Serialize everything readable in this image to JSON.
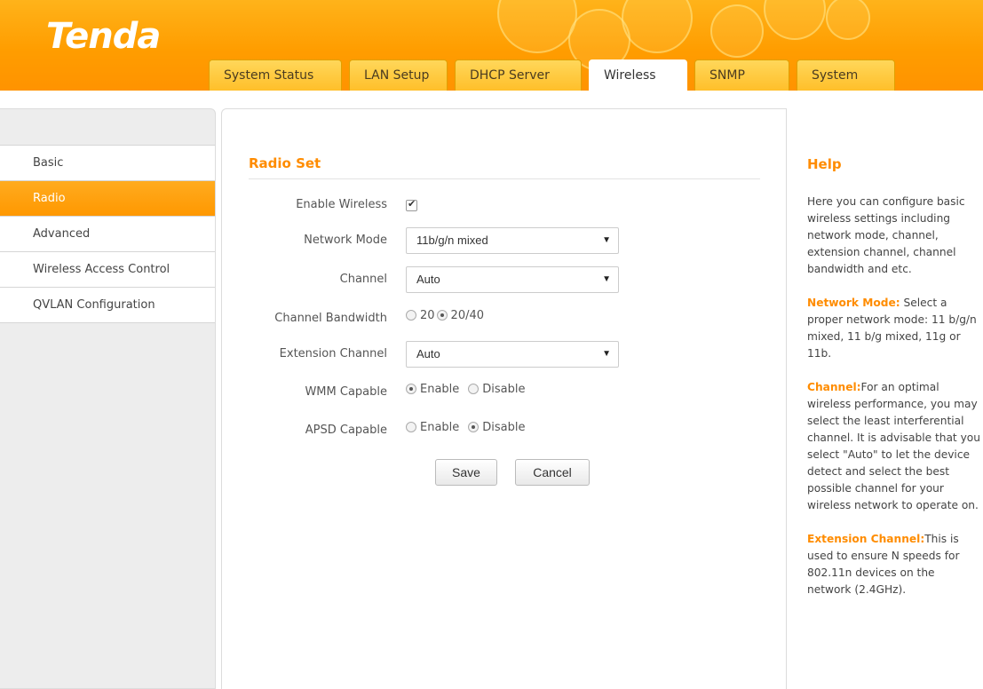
{
  "brand": {
    "logo_text": "Tenda"
  },
  "tabs": [
    {
      "label": "System Status"
    },
    {
      "label": "LAN Setup"
    },
    {
      "label": "DHCP Server"
    },
    {
      "label": "Wireless",
      "active": true
    },
    {
      "label": "SNMP"
    },
    {
      "label": "System"
    }
  ],
  "sidebar": {
    "items": [
      {
        "label": "Basic"
      },
      {
        "label": "Radio",
        "active": true
      },
      {
        "label": "Advanced"
      },
      {
        "label": "Wireless Access Control"
      },
      {
        "label": "QVLAN Configuration"
      }
    ]
  },
  "form": {
    "title": "Radio Set",
    "enable_wireless": {
      "label": "Enable Wireless",
      "checked": true
    },
    "network_mode": {
      "label": "Network Mode",
      "value": "11b/g/n mixed"
    },
    "channel": {
      "label": "Channel",
      "value": "Auto"
    },
    "channel_bandwidth": {
      "label": "Channel Bandwidth",
      "options": [
        "20",
        "20/40"
      ],
      "selected": "20/40"
    },
    "extension_channel": {
      "label": "Extension Channel",
      "value": "Auto"
    },
    "wmm": {
      "label": "WMM Capable",
      "options": [
        "Enable",
        "Disable"
      ],
      "selected": "Enable"
    },
    "apsd": {
      "label": "APSD Capable",
      "options": [
        "Enable",
        "Disable"
      ],
      "selected": "Disable"
    },
    "save_label": "Save",
    "cancel_label": "Cancel"
  },
  "help": {
    "title": "Help",
    "intro": "Here you can configure basic wireless settings including network mode, channel, extension channel, channel bandwidth and etc.",
    "network_mode_kw": "Network Mode:",
    "network_mode_text": " Select a proper network mode: 11 b/g/n mixed, 11 b/g mixed, 11g or 11b.",
    "channel_kw": "Channel:",
    "channel_text": "For an optimal wireless performance, you may select the least interferential channel. It is advisable that you select \"Auto\" to let the device detect and select the best possible channel for your wireless network to operate on.",
    "extension_kw": "Extension Channel:",
    "extension_text": "This is used to ensure N speeds for 802.11n devices on the network (2.4GHz)."
  },
  "colors": {
    "accent": "#ff9800",
    "title": "#ff8c00"
  }
}
